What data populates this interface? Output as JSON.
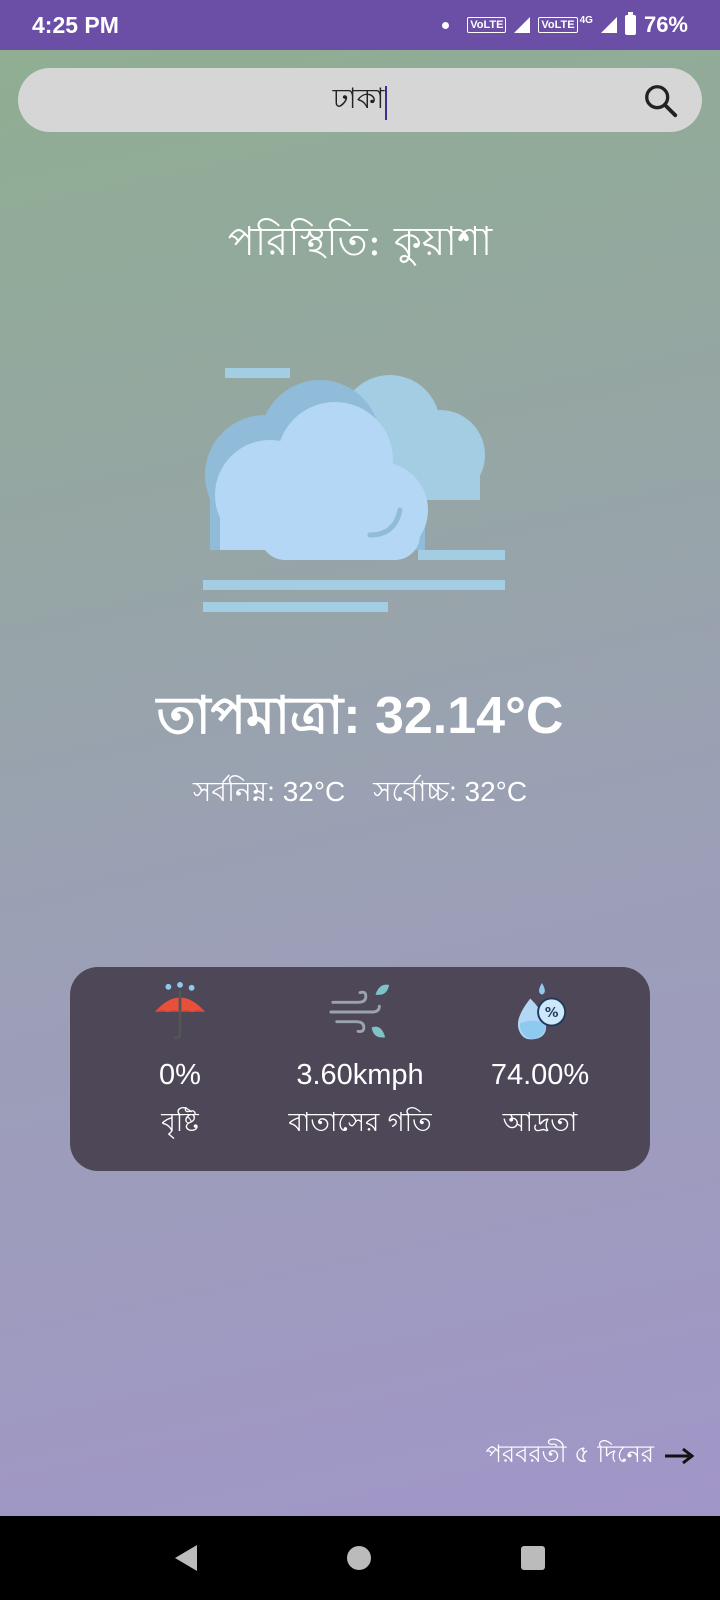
{
  "status_bar": {
    "time": "4:25 PM",
    "volte1": "VoLTE",
    "volte2": "VoLTE",
    "network": "4G",
    "battery": "76%"
  },
  "search": {
    "value": "ঢাকা"
  },
  "weather": {
    "condition": "পরিস্থিতি: কুয়াশা",
    "icon": "fog-cloud-icon",
    "temperature": "তাপমাত্রা: 32.14°C",
    "min": "সর্বনিম্ন: 32°C",
    "max": "সর্বোচ্চ: 32°C"
  },
  "stats": [
    {
      "icon": "umbrella-rain-icon",
      "value": "0%",
      "label": "বৃষ্টি"
    },
    {
      "icon": "wind-icon",
      "value": "3.60kmph",
      "label": "বাতাসের গতি"
    },
    {
      "icon": "humidity-icon",
      "value": "74.00%",
      "label": "আদ্রতা"
    }
  ],
  "footer": {
    "next_days": "পরবরতী ৫ দিনের"
  },
  "colors": {
    "status_bar": "#6b4fa6",
    "card_bg": "#4e4757",
    "search_bg": "#d6d6d6"
  }
}
